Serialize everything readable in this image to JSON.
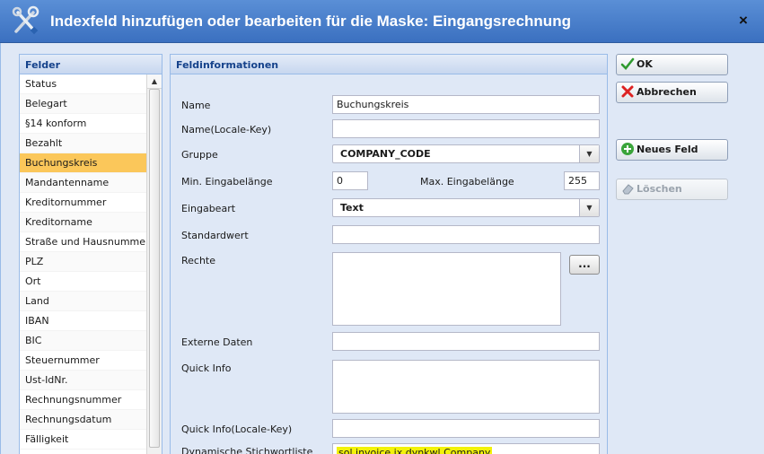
{
  "dialog": {
    "title": "Indexfeld hinzufügen oder bearbeiten für die Maske: Eingangsrechnung",
    "close_label": "×"
  },
  "felder": {
    "header": "Felder",
    "items": [
      "Status",
      "Belegart",
      "§14 konform",
      "Bezahlt",
      "Buchungskreis",
      "Mandantenname",
      "Kreditornummer",
      "Kreditorname",
      "Straße und Hausnummer",
      "PLZ",
      "Ort",
      "Land",
      "IBAN",
      "BIC",
      "Steuernummer",
      "Ust-IdNr.",
      "Rechnungsnummer",
      "Rechnungsdatum",
      "Fälligkeit"
    ],
    "selected": "Buchungskreis"
  },
  "form": {
    "header": "Feldinformationen",
    "name_label": "Name",
    "name_value": "Buchungskreis",
    "locale_key_label": "Name(Locale-Key)",
    "locale_key_value": "",
    "gruppe_label": "Gruppe",
    "gruppe_value": "COMPANY_CODE",
    "min_label": "Min. Eingabelänge",
    "min_value": "0",
    "max_label": "Max. Eingabelänge",
    "max_value": "255",
    "eingabeart_label": "Eingabeart",
    "eingabeart_value": "Text",
    "standardwert_label": "Standardwert",
    "standardwert_value": "",
    "rechte_label": "Rechte",
    "rechte_button": "...",
    "externe_label": "Externe Daten",
    "externe_value": "",
    "quickinfo_label": "Quick Info",
    "quickinfo_locale_label": "Quick Info(Locale-Key)",
    "quickinfo_locale_value": "",
    "dyn_label": "Dynamische Stichwortliste",
    "dyn_value": "sol.invoice.ix.dynkwl.Company"
  },
  "buttons": {
    "ok": "OK",
    "abbrechen": "Abbrechen",
    "neues_feld": "Neues Feld",
    "loeschen": "Löschen"
  },
  "colors": {
    "titlebar": "#3b70c0",
    "selected_row": "#fbc75a",
    "highlight": "#f2f20a"
  }
}
